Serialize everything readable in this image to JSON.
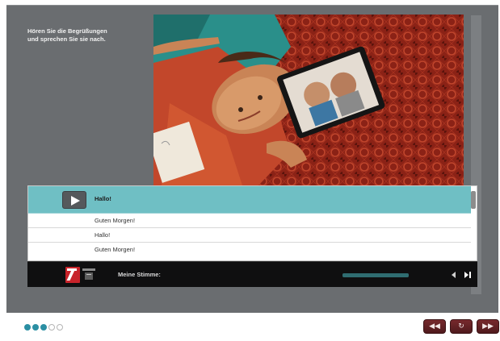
{
  "instruction": {
    "line1": "Hören Sie die Begrüßungen",
    "line2": "und sprechen Sie sie nach."
  },
  "phrases": {
    "active": "Hallo!",
    "row2": "Guten Morgen!",
    "row3": "Hallo!",
    "row4": "Guten Morgen!"
  },
  "recorder": {
    "label": "Meine Stimme:",
    "progress": 1.0
  },
  "progress_dots": {
    "filled": 3,
    "total": 5
  },
  "colors": {
    "stage": "#6a6d70",
    "active_row": "#6fbfc4",
    "record_icon": "#c8232a",
    "dot_filled": "#2b8fa3",
    "nav_button": "#5e1f22"
  },
  "icons": {
    "play": "play-icon",
    "record": "record-icon",
    "back": "rewind-icon",
    "reload": "reload-icon",
    "forward": "fast-forward-icon"
  }
}
